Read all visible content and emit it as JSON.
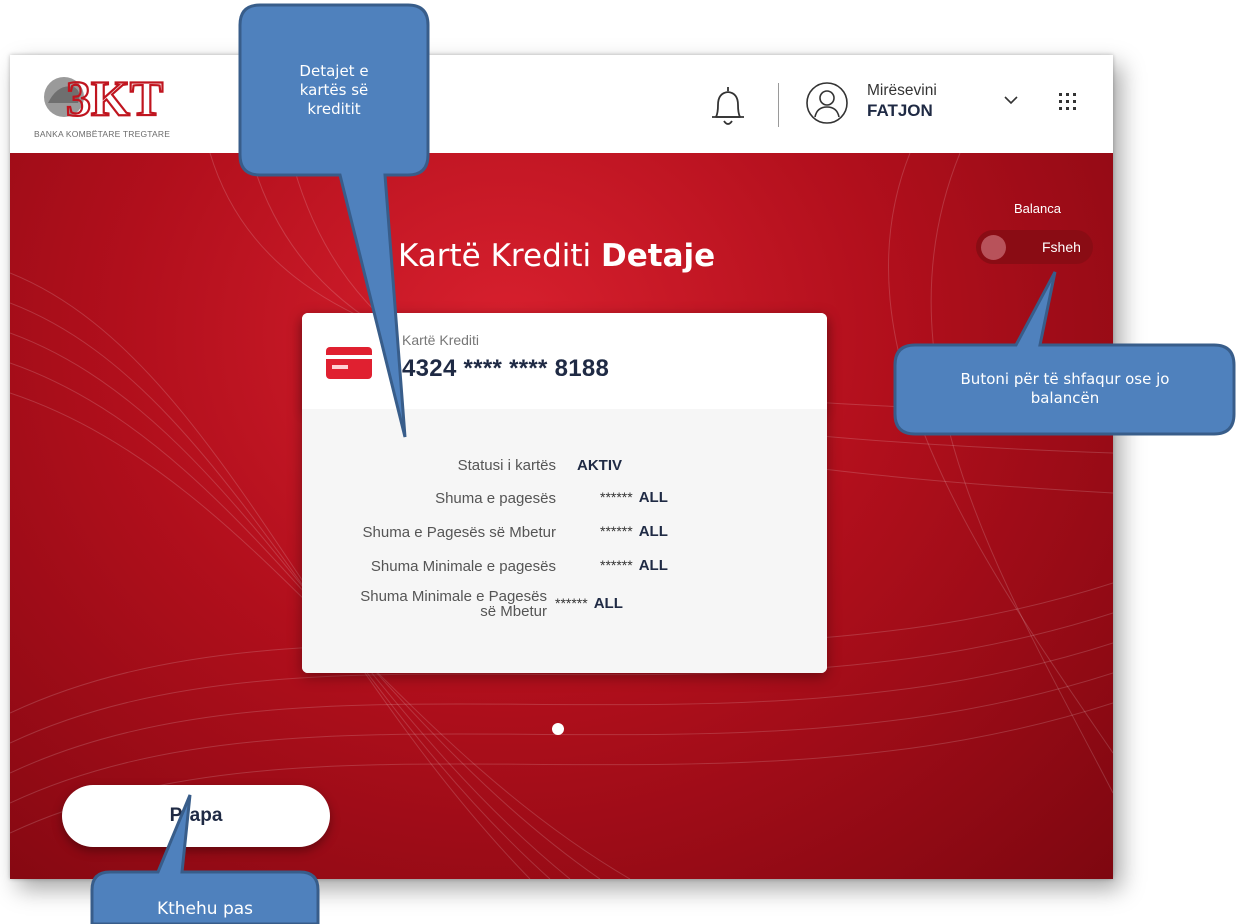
{
  "header": {
    "logo_text": "BKT",
    "logo_tagline": "BANKA KOMBËTARE TREGTARE",
    "greeting": "Mirësevini",
    "user_name": "FATJON"
  },
  "page": {
    "title_light": "Kartë Krediti",
    "title_bold": "Detaje"
  },
  "balance_toggle": {
    "label": "Balanca",
    "state_label": "Fsheh"
  },
  "card": {
    "type_label": "Kartë Krediti",
    "number": "4324 **** **** 8188",
    "details": [
      {
        "label": "Statusi i kartës",
        "value": "AKTIV"
      },
      {
        "label": "Shuma e pagesës",
        "masked": "******",
        "currency": "ALL"
      },
      {
        "label": "Shuma e Pagesës së Mbetur",
        "masked": "******",
        "currency": "ALL"
      },
      {
        "label": "Shuma Minimale e pagesës",
        "masked": "******",
        "currency": "ALL"
      },
      {
        "label_line1": "Shuma Minimale e Pagesës",
        "label_line2": "së Mbetur",
        "masked": "******",
        "currency": "ALL"
      }
    ]
  },
  "back_button": {
    "label": "Prapa"
  },
  "callouts": {
    "card_details": "Detajet e kartës së kreditit",
    "card_details_lines": [
      "Detajet e",
      "kartës së",
      "kreditit"
    ],
    "toggle_help_lines": [
      "Butoni për të shfaqur ose jo",
      "balancën"
    ],
    "back_help": "Kthehu pas"
  },
  "colors": {
    "brand_red": "#c0151f",
    "navy_text": "#1f2a44",
    "callout_fill": "#4f81bd",
    "callout_border": "#385d8a"
  }
}
